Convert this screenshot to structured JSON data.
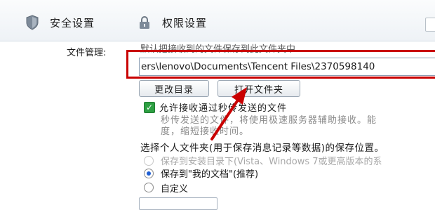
{
  "tabs": {
    "security": "安全设置",
    "permission": "权限设置"
  },
  "file_management": {
    "label": "文件管理:",
    "hint": "默认把接收到的文件保存到此文件夹中",
    "path_value": "ers\\lenovo\\Documents\\Tencent Files\\2370598140",
    "change_dir_button": "更改目录",
    "open_folder_button": "打开文件夹"
  },
  "flash_transfer": {
    "checkbox_label": "允许接收通过秒传发送的文件",
    "checked": true,
    "desc_line1": "秒传发送的文件，将使用极速服务器辅助接收。能",
    "desc_line2": "度，缩短接收时间。"
  },
  "personal_folder": {
    "title": "选择个人文件夹(用于保存消息记录等数据)的保存位置。",
    "options": [
      {
        "label": "保存到安装目录下(Vista、Windows 7或更高版本的系",
        "disabled": true,
        "selected": false
      },
      {
        "label": "保存到\"我的文档\"(推荐)",
        "disabled": false,
        "selected": true
      },
      {
        "label": "自定义",
        "disabled": false,
        "selected": false
      }
    ]
  },
  "colors": {
    "annotation_red": "#c90000",
    "checkbox_green": "#2ea043"
  }
}
